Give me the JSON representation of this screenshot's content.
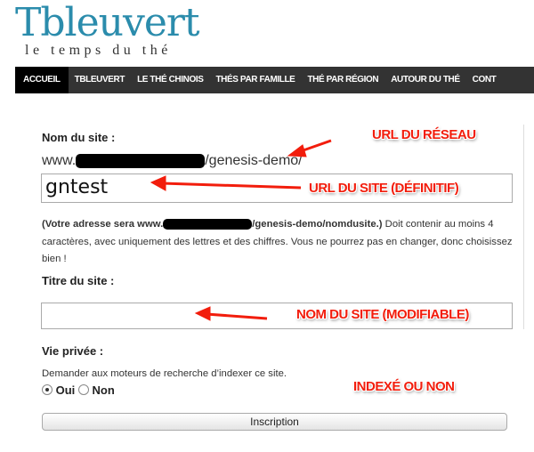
{
  "logo": {
    "title": "Tbleuvert",
    "tagline": "le temps du thé"
  },
  "nav": [
    "ACCUEIL",
    "TBLEUVERT",
    "LE THÉ CHINOIS",
    "THÉS PAR FAMILLE",
    "THÉ PAR RÉGION",
    "AUTOUR DU THÉ",
    "CONT"
  ],
  "form": {
    "site_name_label": "Nom du site :",
    "url_prefix": "www.",
    "url_suffix": "/genesis-demo/",
    "site_name_value": "gntest",
    "help_bold_prefix": "(Votre adresse sera www.",
    "help_bold_suffix": "/genesis-demo/nomdusite.)",
    "help_text": " Doit contenir au moins 4 caractères, avec uniquement des lettres et des chiffres. Vous ne pourrez pas en changer, donc choisissez bien !",
    "title_label": "Titre du site :",
    "title_value": "",
    "privacy_label": "Vie privée :",
    "privacy_text": "Demander aux moteurs de recherche d’indexer ce site.",
    "yes": "Oui",
    "no": "Non",
    "selected": "Oui",
    "submit": "Inscription"
  },
  "annotations": {
    "network_url": "URL DU RÉSEAU",
    "site_url": "URL DU SITE (DÉFINITIF)",
    "site_name": "NOM DU SITE (MODIFIABLE)",
    "indexed": "INDEXÉ OU NON"
  },
  "colors": {
    "logo": "#2b8cac",
    "nav": "#333333",
    "annotation": "#f21d0c"
  }
}
